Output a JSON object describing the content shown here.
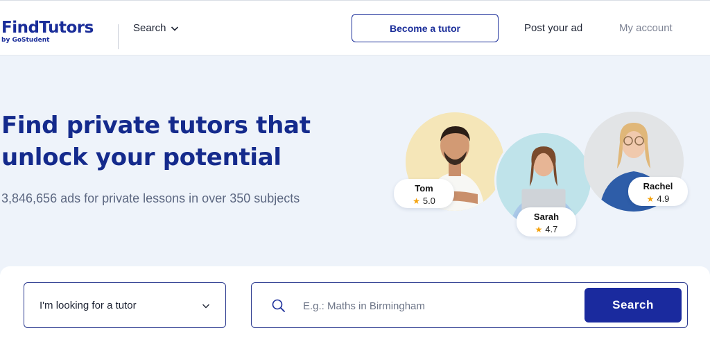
{
  "header": {
    "logo": {
      "name": "FindTutors",
      "byline": "by GoStudent"
    },
    "nav": {
      "search_label": "Search",
      "become_tutor": "Become a tutor",
      "post_ad": "Post your ad",
      "my_account": "My account"
    }
  },
  "hero": {
    "title": "Find private tutors that unlock your potential",
    "subtitle": "3,846,656 ads for private lessons in over 350 subjects"
  },
  "tutors": [
    {
      "name": "Tom",
      "rating": "5.0"
    },
    {
      "name": "Sarah",
      "rating": "4.7"
    },
    {
      "name": "Rachel",
      "rating": "4.9"
    }
  ],
  "search": {
    "mode_selected": "I'm looking for a tutor",
    "placeholder": "E.g.: Maths in Birmingham",
    "button_label": "Search"
  },
  "colors": {
    "brand": "#1a2d99",
    "accent_star": "#f4a20c",
    "background": "#eef3fa"
  }
}
